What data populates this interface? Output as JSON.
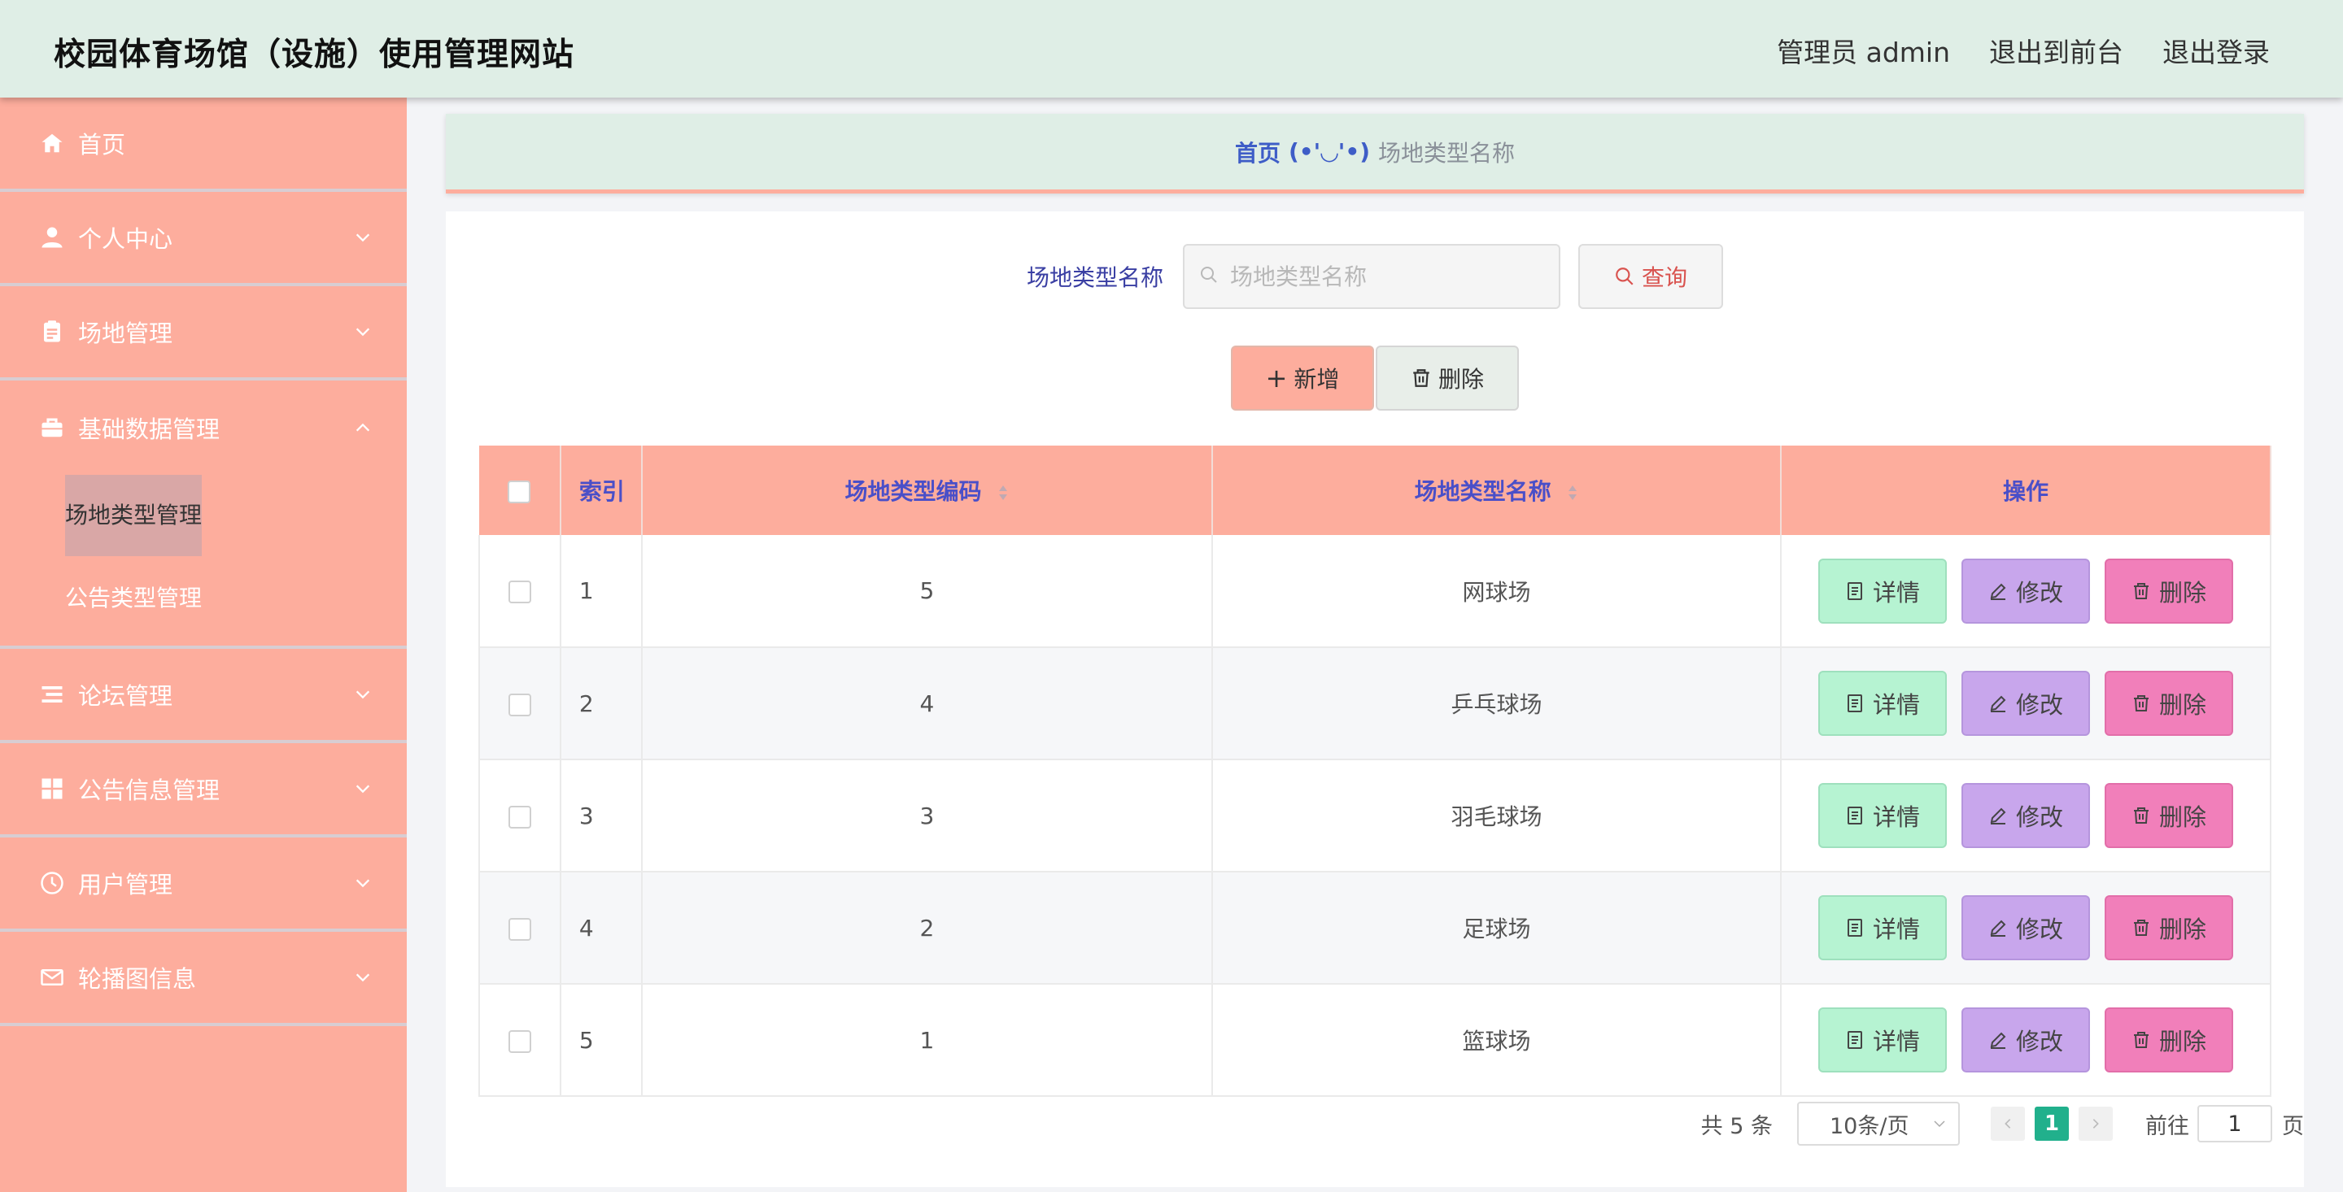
{
  "header": {
    "title": "校园体育场馆（设施）使用管理网站",
    "user": "管理员 admin",
    "to_front": "退出到前台",
    "logout": "退出登录"
  },
  "sidebar": {
    "items": [
      {
        "label": "首页",
        "icon": "home-icon"
      },
      {
        "label": "个人中心",
        "icon": "user-icon"
      },
      {
        "label": "场地管理",
        "icon": "clipboard-icon"
      },
      {
        "label": "基础数据管理",
        "icon": "briefcase-icon",
        "expanded": true,
        "children": [
          {
            "label": "场地类型管理",
            "active": true
          },
          {
            "label": "公告类型管理"
          }
        ]
      },
      {
        "label": "论坛管理",
        "icon": "list-icon"
      },
      {
        "label": "公告信息管理",
        "icon": "grid-icon"
      },
      {
        "label": "用户管理",
        "icon": "clock-icon"
      },
      {
        "label": "轮播图信息",
        "icon": "mail-icon"
      }
    ]
  },
  "breadcrumb": {
    "home": "首页",
    "face": "(•'◡'•)",
    "current": "场地类型名称"
  },
  "search": {
    "label": "场地类型名称",
    "placeholder": "场地类型名称",
    "value": "",
    "query_label": "查询"
  },
  "actions": {
    "add_label": "新增",
    "delete_label": "删除"
  },
  "table": {
    "headers": {
      "index": "索引",
      "code": "场地类型编码",
      "name": "场地类型名称",
      "ops": "操作"
    },
    "rows": [
      {
        "index": "1",
        "code": "5",
        "name": "网球场"
      },
      {
        "index": "2",
        "code": "4",
        "name": "乒乓球场"
      },
      {
        "index": "3",
        "code": "3",
        "name": "羽毛球场"
      },
      {
        "index": "4",
        "code": "2",
        "name": "足球场"
      },
      {
        "index": "5",
        "code": "1",
        "name": "篮球场"
      }
    ],
    "op_detail": "详情",
    "op_edit": "修改",
    "op_delete": "删除"
  },
  "pagination": {
    "total": "共 5 条",
    "page_size": "10条/页",
    "current_page": "1",
    "goto_label": "前往",
    "goto_value": "1",
    "unit": "页"
  },
  "colors": {
    "header_bg": "#dfeee6",
    "sidebar_bg": "#fdad9d",
    "table_header_bg": "#fdad9d",
    "detail_btn": "#b6f3d2",
    "edit_btn": "#c8a6ec",
    "delete_btn": "#f17fba",
    "active_page": "#21b08c"
  }
}
